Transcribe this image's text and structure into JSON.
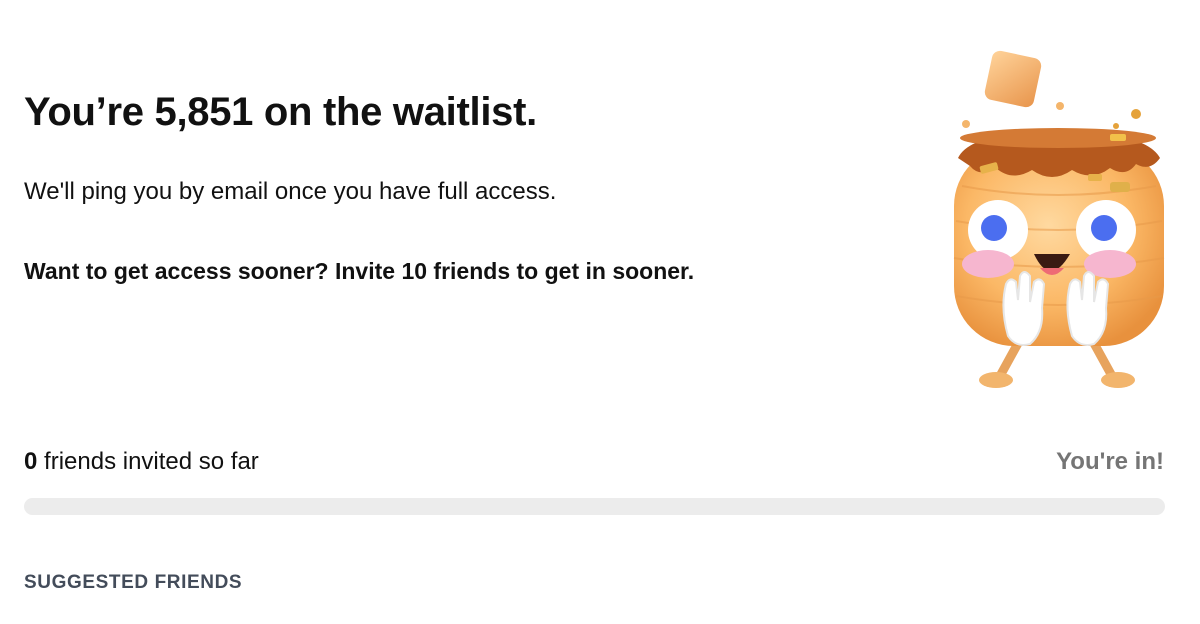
{
  "waitlist": {
    "headline": "You’re 5,851 on the waitlist.",
    "subtitle": "We'll ping you by email once you have full access.",
    "cta": "Want to get access sooner? Invite 10 friends to get in sooner."
  },
  "progress": {
    "invited_count": "0",
    "invited_suffix": " friends invited so far",
    "goal_label": "You're in!",
    "fraction": 0
  },
  "suggested": {
    "heading": "SUGGESTED FRIENDS"
  },
  "icons": {
    "mascot": "pancake-mascot-icon"
  },
  "colors": {
    "track": "#ececec",
    "fill": "#111111",
    "goal_text": "#757575",
    "section_label": "#434c5a"
  }
}
